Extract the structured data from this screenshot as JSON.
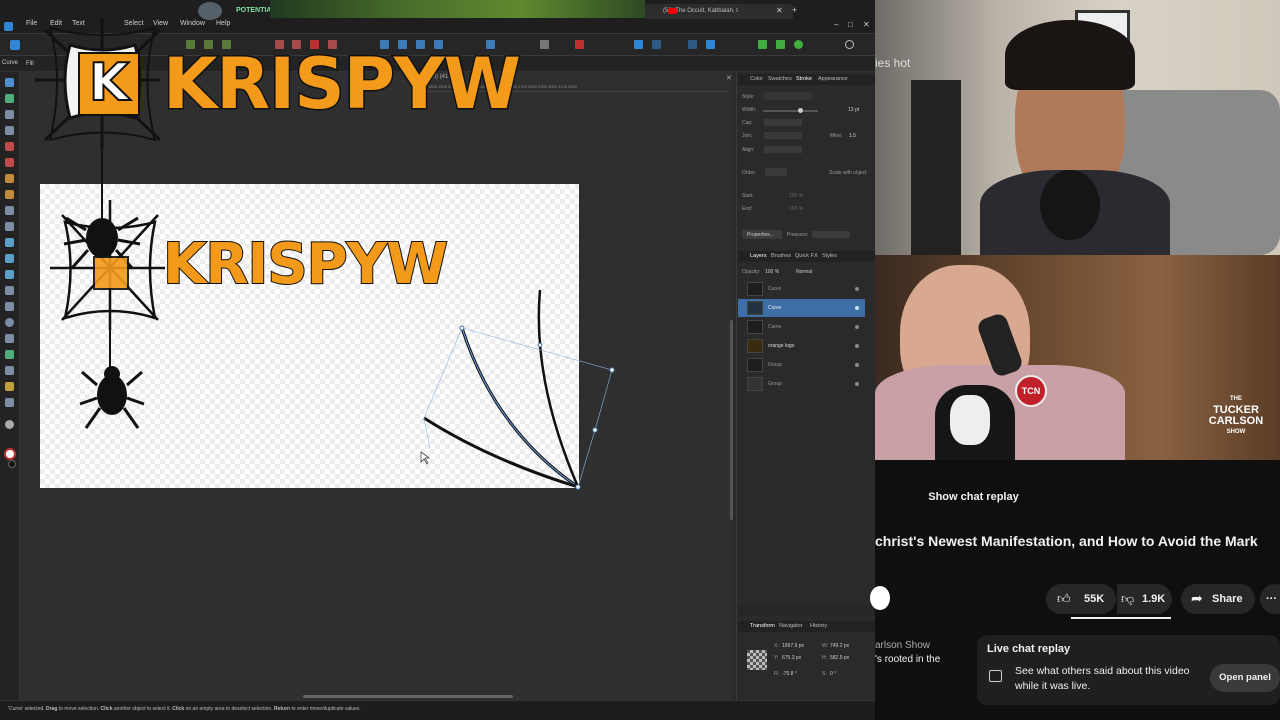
{
  "designer": {
    "menu": [
      "File",
      "Edit",
      "Text",
      "Select",
      "View",
      "Window",
      "Help"
    ],
    "potential_label": "POTENTIAL",
    "browser_tab_title": "(50) The Occult, Kabbalah, t",
    "context_label": "Curve",
    "context_fill_label": "Fill",
    "doc_tab": "ified) (41.0%)",
    "ruler_ticks": "1800  1900  2000  2100  2200  2300  2400  2500  2600  2700  2800  2900  3000  3100  3200",
    "logo_text": "KRISPYW",
    "logo_letter": "K",
    "status": {
      "selected": "'Curve' selected.",
      "drag": "Drag",
      "drag_text": "to move selection.",
      "click1": "Click",
      "click1_text": "another object to select it.",
      "click2": "Click",
      "click2_text": "on an empty area to deselect selection.",
      "ret": "Return",
      "ret_text": "to enter move/duplicate values."
    },
    "accent_color": "#3d6fa6",
    "logo_color": "#f39a1b"
  },
  "stroke_panel": {
    "tabs": [
      "Color",
      "Swatches",
      "Stroke",
      "Appearance"
    ],
    "style_label": "Style:",
    "width_label": "Width:",
    "width_value": "13 pt",
    "cap_label": "Cap:",
    "join_label": "Join:",
    "mitre_label": "Mitre:",
    "mitre_value": "1.5",
    "align_label": "Align:",
    "order_label": "Order:",
    "scale_label": "Scale with object",
    "start_label": "Start:",
    "end_label": "End:",
    "start_pct": "100 %",
    "end_pct": "100 %",
    "properties_btn": "Properties...",
    "pressure_label": "Pressure:"
  },
  "layers_panel": {
    "tabs": [
      "Layers",
      "Brushes",
      "Quick FX",
      "Styles"
    ],
    "opacity_label": "Opacity:",
    "opacity_value": "100 %",
    "blend_mode": "Normal",
    "layers": [
      {
        "name": "Curve"
      },
      {
        "name": "Curve"
      },
      {
        "name": "Curve"
      },
      {
        "name": "orange logo"
      },
      {
        "name": "Group"
      },
      {
        "name": "Group"
      }
    ]
  },
  "transform_panel": {
    "tabs": [
      "Transform",
      "Navigator",
      "History"
    ],
    "x_label": "X:",
    "x_value": "1997.9 px",
    "y_label": "Y:",
    "y_value": "675.3 px",
    "w_label": "W:",
    "w_value": "749.2 px",
    "h_label": "H:",
    "h_value": "582.5 px",
    "r_label": "R:",
    "r_value": "-75.8 °",
    "s_label": "S:",
    "s_value": "0 °"
  },
  "video": {
    "under_title": "ies hot",
    "tucker_line1": "THE",
    "tucker_line2": "TUCKER",
    "tucker_line3": "CARLSON",
    "tucker_line4": "SHOW",
    "tcn": "TCN"
  },
  "youtube": {
    "show_chat_replay": "Show chat replay",
    "title": "christ's Newest Manifestation, and How to Avoid the Mark",
    "likes": "55K",
    "dislikes": "1.9K",
    "share": "Share",
    "more": "···",
    "channel_partial": "arlson Show",
    "desc_partial": "'s rooted in the",
    "live_chat_title": "Live chat replay",
    "live_chat_desc": "See what others said about this video while it was live.",
    "open_panel": "Open panel"
  }
}
